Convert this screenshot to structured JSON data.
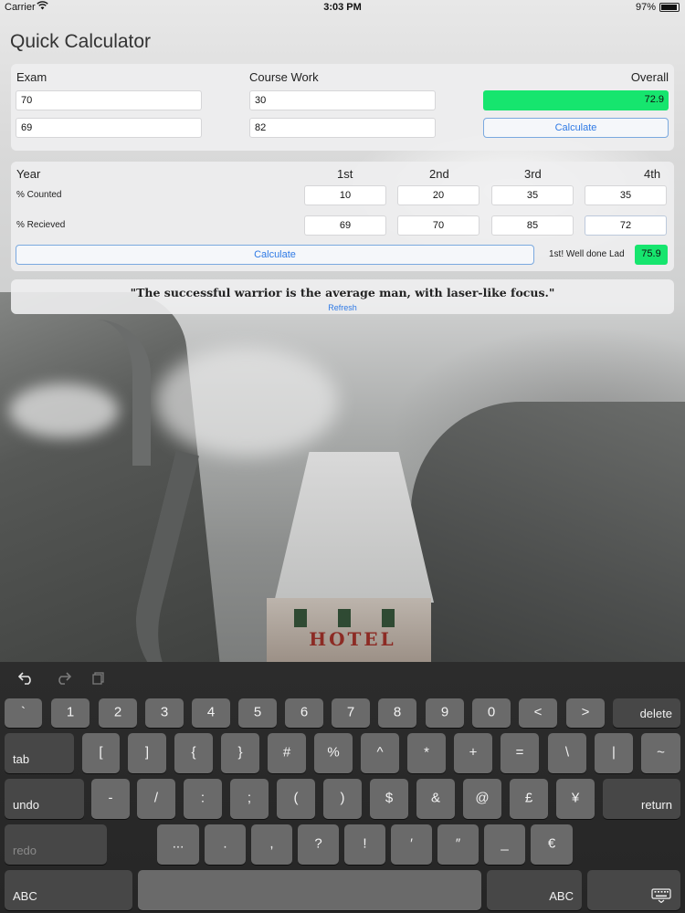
{
  "status_bar": {
    "carrier": "Carrier",
    "wifi_icon": "wifi-icon",
    "time": "3:03 PM",
    "battery": "97%",
    "battery_level": 0.97
  },
  "app": {
    "title": "Quick Calculator"
  },
  "quick_panel": {
    "exam_label": "Exam",
    "coursework_label": "Course Work",
    "overall_label": "Overall",
    "exam_value": "70",
    "exam_weight": "69",
    "coursework_value": "30",
    "coursework_weight": "82",
    "overall_result": "72.9",
    "calculate_label": "Calculate"
  },
  "year_panel": {
    "year_label": "Year",
    "years": [
      "1st",
      "2nd",
      "3rd",
      "4th"
    ],
    "counted_label": "% Counted",
    "received_label": "% Recieved",
    "counted": [
      "10",
      "20",
      "35",
      "35"
    ],
    "received": [
      "69",
      "70",
      "85",
      "72"
    ],
    "calculate_label": "Calculate",
    "result_message": "1st! Well done Lad",
    "result_value": "75.9"
  },
  "quote": {
    "text": "\"The successful warrior is the average man, with laser-like focus.\"",
    "refresh_label": "Refresh"
  },
  "background": {
    "sign_text": "HOTEL"
  },
  "keyboard": {
    "toolbar": [
      "undo-icon",
      "redo-icon",
      "paste-icon"
    ],
    "row1": [
      "`",
      "1",
      "2",
      "3",
      "4",
      "5",
      "6",
      "7",
      "8",
      "9",
      "0",
      "<",
      ">"
    ],
    "delete_label": "delete",
    "tab_label": "tab",
    "row2": [
      "[",
      "]",
      "{",
      "}",
      "#",
      "%",
      "^",
      "*",
      "+",
      "=",
      "\\",
      "|",
      "~"
    ],
    "undo_label": "undo",
    "row3": [
      "-",
      "/",
      ":",
      ";",
      "(",
      ")",
      "$",
      "&",
      "@",
      "£",
      "¥"
    ],
    "return_label": "return",
    "redo_label": "redo",
    "row4": [
      "...",
      ".",
      ",",
      "?",
      "!",
      "′",
      "″",
      "_",
      "€"
    ],
    "abc_label": "ABC",
    "hide_keyboard_icon": "keyboard-dismiss-icon"
  },
  "colors": {
    "accent": "#2f7ae5",
    "result_green": "#16e56e",
    "keyboard_bg": "#2a2a2a",
    "key_bg": "#6a6a6a"
  }
}
